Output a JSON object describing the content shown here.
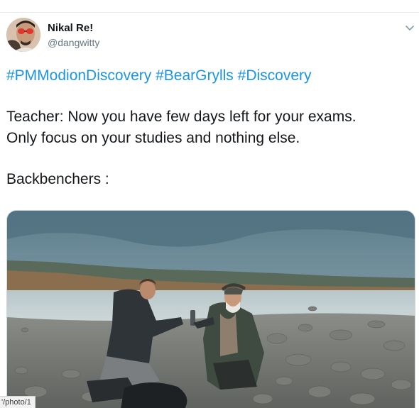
{
  "header": {
    "display_name": "Nikal Re!",
    "handle": "@dangwitty",
    "menu_icon": "chevron-down-icon"
  },
  "tweet": {
    "hashtags": [
      "#PMModionDiscovery",
      "#BearGrylls",
      "#Discovery"
    ],
    "line1": "Teacher: Now you have few days left for your exams.",
    "line2": "Only focus on your studies and nothing else.",
    "line3": "Backbenchers :"
  },
  "status_bar": {
    "url_fragment": "'/photo/1"
  },
  "colors": {
    "link": "#1b95e0",
    "text": "#14171a",
    "secondary": "#657786"
  }
}
